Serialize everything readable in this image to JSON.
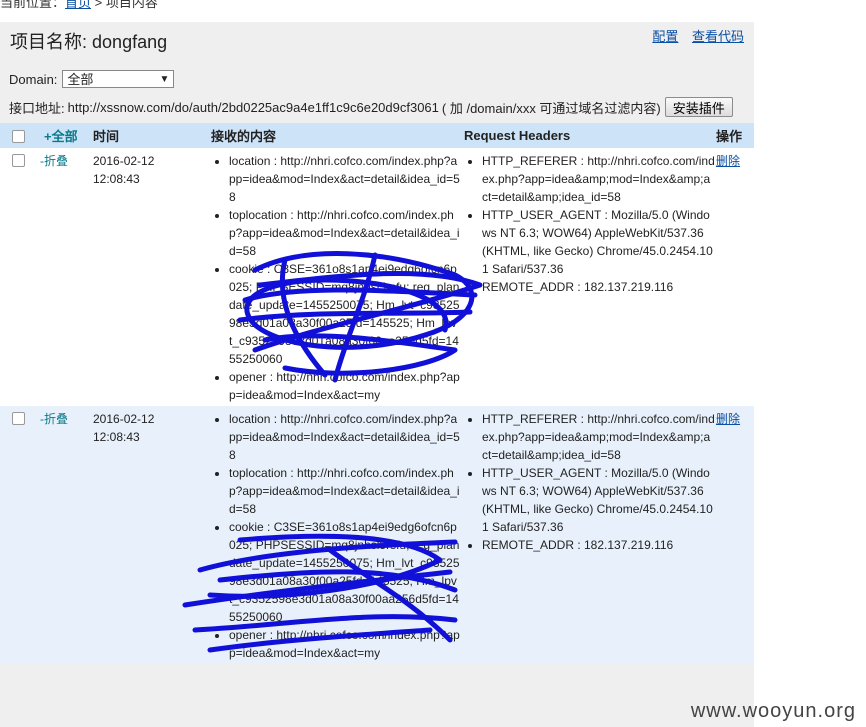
{
  "breadcrumb": {
    "prefix": "当前位置：",
    "link": "首页",
    "suffix": " > 项目内容"
  },
  "project": {
    "title_label": "项目名称:",
    "name": "dongfang"
  },
  "toplinks": {
    "config": "配置",
    "view_code": "查看代码"
  },
  "domain": {
    "label": "Domain:",
    "selected": "全部",
    "arrow": "▼"
  },
  "api": {
    "label": "接口地址:",
    "url": "http://xssnow.com/do/auth/2bd0225ac9a4e1ff1c9c6e20d9cf3061",
    "hint": "( 加 /domain/xxx 可通过域名过滤内容)",
    "install_button": "安装插件"
  },
  "table": {
    "headers": {
      "toggle_all": "+全部",
      "time": "时间",
      "content": "接收的内容",
      "request_headers": "Request Headers",
      "actions": "操作"
    },
    "rows": [
      {
        "toggle": "-折叠",
        "date": "2016-02-12",
        "time": "12:08:43",
        "content": [
          "location : http://nhri.cofco.com/index.php?app=idea&mod=Index&act=detail&idea_id=58",
          "toplocation : http://nhri.cofco.com/index.php?app=idea&mod=Index&act=detail&idea_id=58",
          "cookie : C3SE=361o8s1ap4ei9edg6ofcn6p025; PHPSESSID=mq8jnhsl5rsfu; reg_plandate_update=1455250075; Hm_lvt_c9352598e3d01a08a30f00a25fd=145525; Hm_lpvt_c9352598e3d01a08a30f00aa256d5fd=1455250060",
          "opener : http://nhri.cofco.com/index.php?app=idea&mod=Index&act=my"
        ],
        "headers": [
          "HTTP_REFERER : http://nhri.cofco.com/index.php?app=idea&amp;mod=Index&amp;act=detail&amp;idea_id=58",
          "HTTP_USER_AGENT : Mozilla/5.0 (Windows NT 6.3; WOW64) AppleWebKit/537.36 (KHTML, like Gecko) Chrome/45.0.2454.101 Safari/537.36",
          "REMOTE_ADDR : 182.137.219.116"
        ],
        "delete": "删除"
      },
      {
        "toggle": "-折叠",
        "date": "2016-02-12",
        "time": "12:08:43",
        "content": [
          "location : http://nhri.cofco.com/index.php?app=idea&mod=Index&act=detail&idea_id=58",
          "toplocation : http://nhri.cofco.com/index.php?app=idea&mod=Index&act=detail&idea_id=58",
          "cookie : C3SE=361o8s1ap4ei9edg6ofcn6p025; PHPSESSID=mq8jnhsl5rsfu; reg_plandate_update=1455250075; Hm_lvt_c9352598e3d01a08a30f00a25fd=145525; Hm_lpvt_c9352598e3d01a08a30f00aa256d5fd=1455250060",
          "opener : http://nhri.cofco.com/index.php?app=idea&mod=Index&act=my"
        ],
        "headers": [
          "HTTP_REFERER : http://nhri.cofco.com/index.php?app=idea&amp;mod=Index&amp;act=detail&amp;idea_id=58",
          "HTTP_USER_AGENT : Mozilla/5.0 (Windows NT 6.3; WOW64) AppleWebKit/537.36 (KHTML, like Gecko) Chrome/45.0.2454.101 Safari/537.36",
          "REMOTE_ADDR : 182.137.219.116"
        ],
        "delete": "删除"
      }
    ]
  },
  "watermark": "www.wooyun.org",
  "colors": {
    "header_bg": "#cde3f7",
    "row_alt_bg": "#e8f1fb",
    "link": "#0a4fa3",
    "scribble": "#1010d8"
  }
}
